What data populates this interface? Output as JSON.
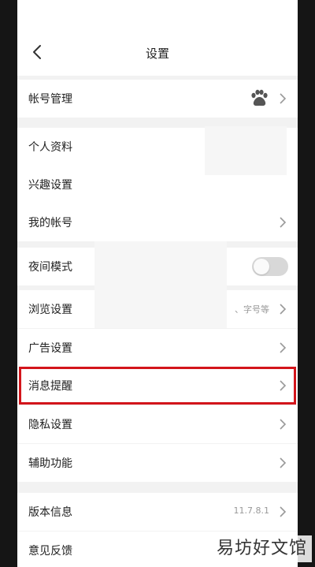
{
  "header": {
    "title": "设置"
  },
  "sections": [
    {
      "items": [
        {
          "label": "帐号管理",
          "trailing": "bear-icon"
        }
      ]
    },
    {
      "items": [
        {
          "label": "个人资料"
        },
        {
          "label": "兴趣设置"
        },
        {
          "label": "我的帐号"
        }
      ]
    },
    {
      "items": [
        {
          "label": "夜间模式",
          "toggle_on": false
        },
        {
          "label": "浏览设置",
          "hint": "、字号等"
        },
        {
          "label": "广告设置"
        },
        {
          "label": "消息提醒",
          "highlighted": true
        },
        {
          "label": "隐私设置"
        },
        {
          "label": "辅助功能"
        }
      ]
    },
    {
      "items": [
        {
          "label": "版本信息",
          "hint": "11.7.8.1"
        },
        {
          "label": "意见反馈"
        }
      ]
    }
  ],
  "watermark": "易坊好文馆",
  "colors": {
    "highlight": "#d3151b",
    "toggle_off": "#d8d8d8"
  }
}
